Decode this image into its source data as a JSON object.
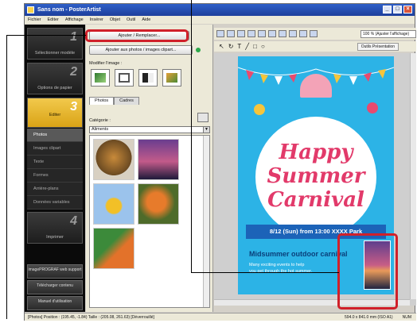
{
  "window": {
    "title": "Sans nom - PosterArtist",
    "controls": [
      "_",
      "□",
      "×"
    ]
  },
  "menubar": [
    "Fichier",
    "Editer",
    "Affichage",
    "Insérer",
    "Objet",
    "Outil",
    "Aide"
  ],
  "steps": [
    {
      "num": "1",
      "label": "Sélectionner modèle"
    },
    {
      "num": "2",
      "label": "Options de papier"
    },
    {
      "num": "3",
      "label": "Editer"
    },
    {
      "num": "4",
      "label": "Imprimer"
    }
  ],
  "edit_subitems": [
    "Photos",
    "Images clipart",
    "Texte",
    "Formes",
    "Arrière-plans",
    "Données variables"
  ],
  "bottom_buttons": [
    "imagePROGRAF web support",
    "Télécharger contenu",
    "Manuel d'utilisation"
  ],
  "panel": {
    "replace_button": "Ajouter / Remplacer...",
    "add_photos_link": "Ajouter aux photos / images clipart...",
    "modify_image_label": "Modifier l'image :",
    "tabs": [
      "Photos",
      "Cadres"
    ],
    "category_label": "Catégorie :",
    "category_value": "Aliments"
  },
  "toolbar": {
    "zoom": "100 % (Ajuster l'affichage)",
    "outils_presentation": "Outils Présentation"
  },
  "poster": {
    "line1": "Happy",
    "line2": "Summer",
    "line3": "Carnival",
    "date_line": "8/12 (Sun) from 13:00  XXXX Park",
    "event_title": "Midsummer outdoor carnival",
    "desc1": "Many exciting events to help",
    "desc2": "you get through the hot summer."
  },
  "status": {
    "left": "[Photos] Position : (195.45, -1.84) Taille : (205.08, 261.63) [Déverrouillé]",
    "size": "594.0 x 841.0 mm (ISO A1)",
    "mode": "NUM"
  }
}
